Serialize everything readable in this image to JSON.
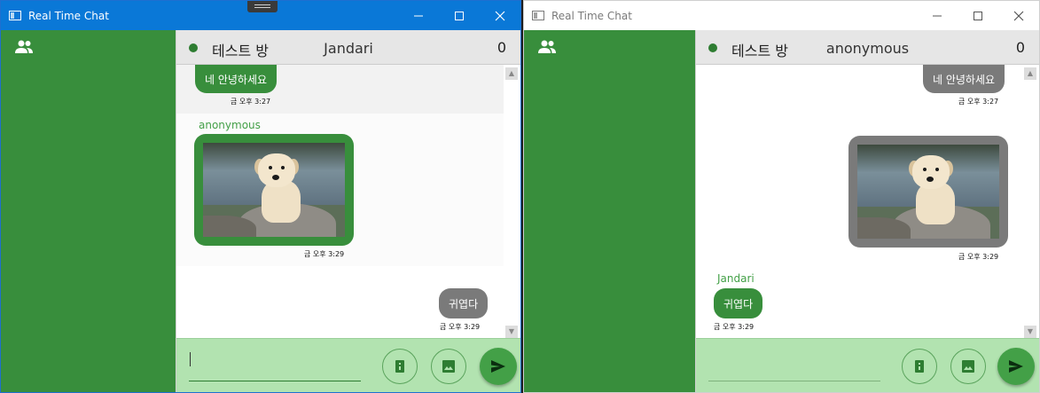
{
  "colors": {
    "sidebar_green": "#388e3c",
    "bubble_green": "#388e3c",
    "bubble_gray": "#7a7a7a",
    "input_bar": "#b2e3b0",
    "send_button": "#43a047",
    "titlebar_active": "#0a78d7"
  },
  "windows": [
    {
      "app_title": "Real Time Chat",
      "active": true,
      "header": {
        "room": "테스트 방",
        "user": "Jandari",
        "count": "0"
      },
      "messages": [
        {
          "type": "text",
          "side": "left",
          "color": "green",
          "text": "네 안녕하세요",
          "time": "금 오후 3:27"
        },
        {
          "type": "image",
          "side": "left",
          "color": "green",
          "sender": "anonymous",
          "time": "금 오후 3:29"
        },
        {
          "type": "text",
          "side": "right",
          "color": "gray",
          "text": "귀엽다",
          "time": "금 오후 3:29"
        }
      ],
      "input": {
        "value": "",
        "placeholder": ""
      },
      "icons": [
        "people-icon",
        "file-icon",
        "image-icon",
        "send-icon"
      ]
    },
    {
      "app_title": "Real Time Chat",
      "active": false,
      "header": {
        "room": "테스트 방",
        "user": "anonymous",
        "count": "0"
      },
      "messages": [
        {
          "type": "text",
          "side": "right",
          "color": "gray",
          "text": "네 안녕하세요",
          "time": "금 오후 3:27"
        },
        {
          "type": "image",
          "side": "right",
          "color": "gray",
          "time": "금 오후 3:29"
        },
        {
          "type": "text",
          "side": "left",
          "color": "green",
          "sender": "Jandari",
          "text": "귀엽다",
          "time": "금 오후 3:29"
        }
      ],
      "input": {
        "value": "",
        "placeholder": ""
      },
      "icons": [
        "people-icon",
        "file-icon",
        "image-icon",
        "send-icon"
      ]
    }
  ]
}
